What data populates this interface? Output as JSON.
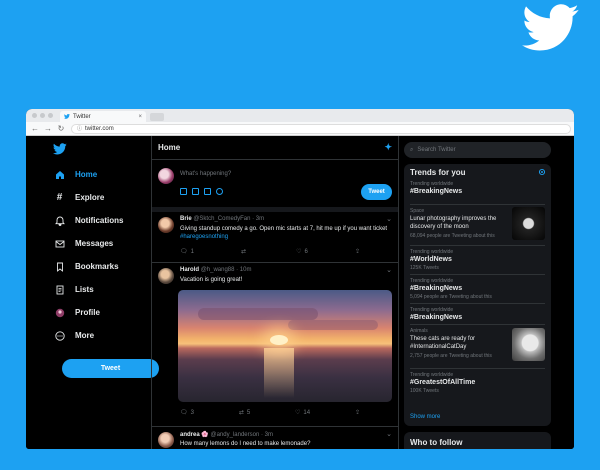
{
  "browser": {
    "tab_title": "Twitter",
    "tab_close": "×",
    "url": "twitter.com"
  },
  "colors": {
    "brand": "#1da1f2",
    "background": "#000000",
    "panel": "#16181c"
  },
  "nav": {
    "items": [
      {
        "label": "Home",
        "icon": "home-icon",
        "active": true
      },
      {
        "label": "Explore",
        "icon": "hashtag-icon"
      },
      {
        "label": "Notifications",
        "icon": "bell-icon"
      },
      {
        "label": "Messages",
        "icon": "envelope-icon"
      },
      {
        "label": "Bookmarks",
        "icon": "bookmark-icon"
      },
      {
        "label": "Lists",
        "icon": "list-icon"
      },
      {
        "label": "Profile",
        "icon": "profile-icon"
      },
      {
        "label": "More",
        "icon": "more-icon"
      }
    ],
    "tweet_button": "Tweet"
  },
  "feed": {
    "title": "Home",
    "compose": {
      "placeholder": "What's happening?",
      "button": "Tweet"
    },
    "tweets": [
      {
        "name": "Brie",
        "meta": "@Sktch_ComedyFan · 3m",
        "text": "Giving standup comedy a go. Open mic starts at 7, hit me up if you want ticket ",
        "hashtag": "#haregoesnothing",
        "replies": "1",
        "retweets": "",
        "likes": "6"
      },
      {
        "name": "Harold",
        "meta": "@h_wang88 · 10m",
        "text": "Vacation is going great!",
        "replies": "3",
        "retweets": "5",
        "likes": "14"
      },
      {
        "name": "andrea 🌸",
        "meta": "@andy_landerson · 3m",
        "text": "How many lemons do I need to make lemonade?"
      }
    ]
  },
  "sidebar": {
    "search_placeholder": "Search Twitter",
    "trends_title": "Trends for you",
    "trends": [
      {
        "context": "Trending worldwide",
        "name": "#BreakingNews"
      },
      {
        "context": "Space",
        "text": "Lunar photography improves the discovery of the moon",
        "count": "68,094 people are Tweeting about this"
      },
      {
        "context": "Trending worldwide",
        "name": "#WorldNews",
        "count": "125K Tweets"
      },
      {
        "context": "Trending worldwide",
        "name": "#BreakingNews",
        "count": "5,094 people are Tweeting about this"
      },
      {
        "context": "Trending worldwide",
        "name": "#BreakingNews"
      },
      {
        "context": "Animals",
        "text": "These cats are ready for #InternationalCatDay",
        "count": "2,757 people are Tweeting about this"
      },
      {
        "context": "Trending worldwide",
        "name": "#GreatestOfAllTime",
        "count": "100K Tweets"
      }
    ],
    "show_more": "Show more",
    "who_to_follow": "Who to follow"
  }
}
